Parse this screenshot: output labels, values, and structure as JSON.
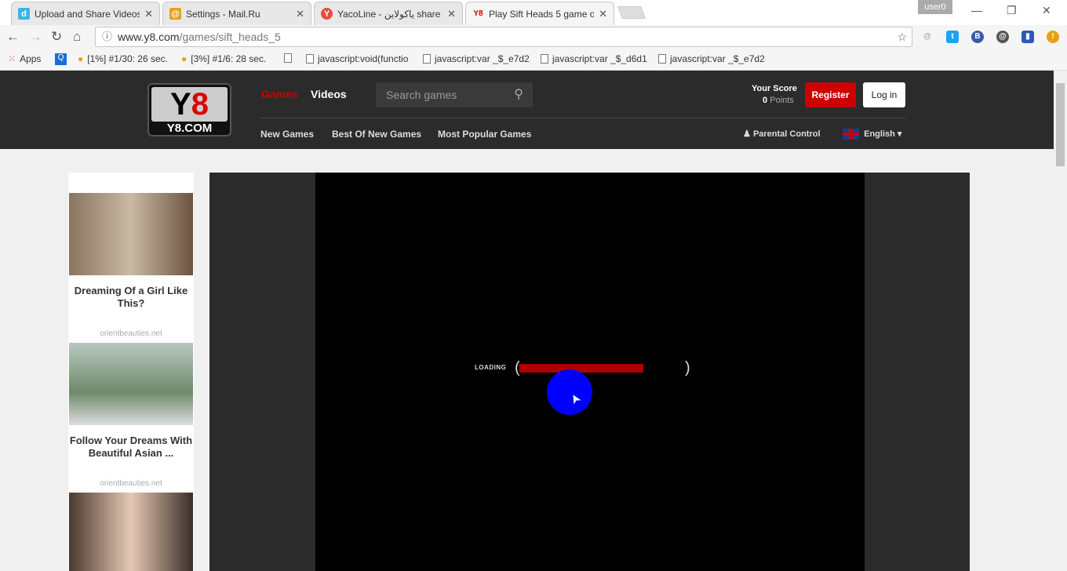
{
  "browser": {
    "tabs": [
      {
        "title": "Upload and Share Videos",
        "icon": "dailymotion-icon",
        "color": "#3bb4e6",
        "glyph": "d"
      },
      {
        "title": "Settings - Mail.Ru",
        "icon": "mailru-icon",
        "color": "#e8a020",
        "glyph": "@"
      },
      {
        "title": "YacoLine - ياكولاين share",
        "icon": "yacoline-icon",
        "color": "#e74c3c",
        "glyph": "Y"
      },
      {
        "title": "Play Sift Heads 5 game o",
        "icon": "y8-icon",
        "color": "#ffffff",
        "glyph": "Y8"
      }
    ],
    "active_tab": 3,
    "user": "user0",
    "url_host": "www.y8.com",
    "url_path": "/games/sift_heads_5",
    "bookmarks": [
      "Apps",
      "[1%] #1/30: 26 sec.",
      "[3%] #1/6: 28 sec.",
      "",
      "javascript:void(functio",
      "javascript:var _$_e7d2",
      "javascript:var _$_d6d1",
      "javascript:var _$_e7d2"
    ]
  },
  "site": {
    "logo_top": "Y8",
    "logo_bottom": "Y8.COM",
    "nav": {
      "games": "Games",
      "videos": "Videos"
    },
    "search_placeholder": "Search games",
    "score_label": "Your Score",
    "score_value": "0",
    "score_unit": "Points",
    "register": "Register",
    "login": "Log in",
    "subnav": [
      "New Games",
      "Best Of New Games",
      "Most Popular Games"
    ],
    "parental": "Parental Control",
    "language": "English",
    "accent": "#cc0000"
  },
  "ads": [
    {
      "title": "Dreaming Of a Girl Like This?",
      "source": "orientbeauties.net"
    },
    {
      "title": "Follow Your Dreams With Beautiful Asian ...",
      "source": "orientbeauties.net"
    }
  ],
  "game": {
    "loading_label": "LOADING",
    "progress": 0.75
  }
}
